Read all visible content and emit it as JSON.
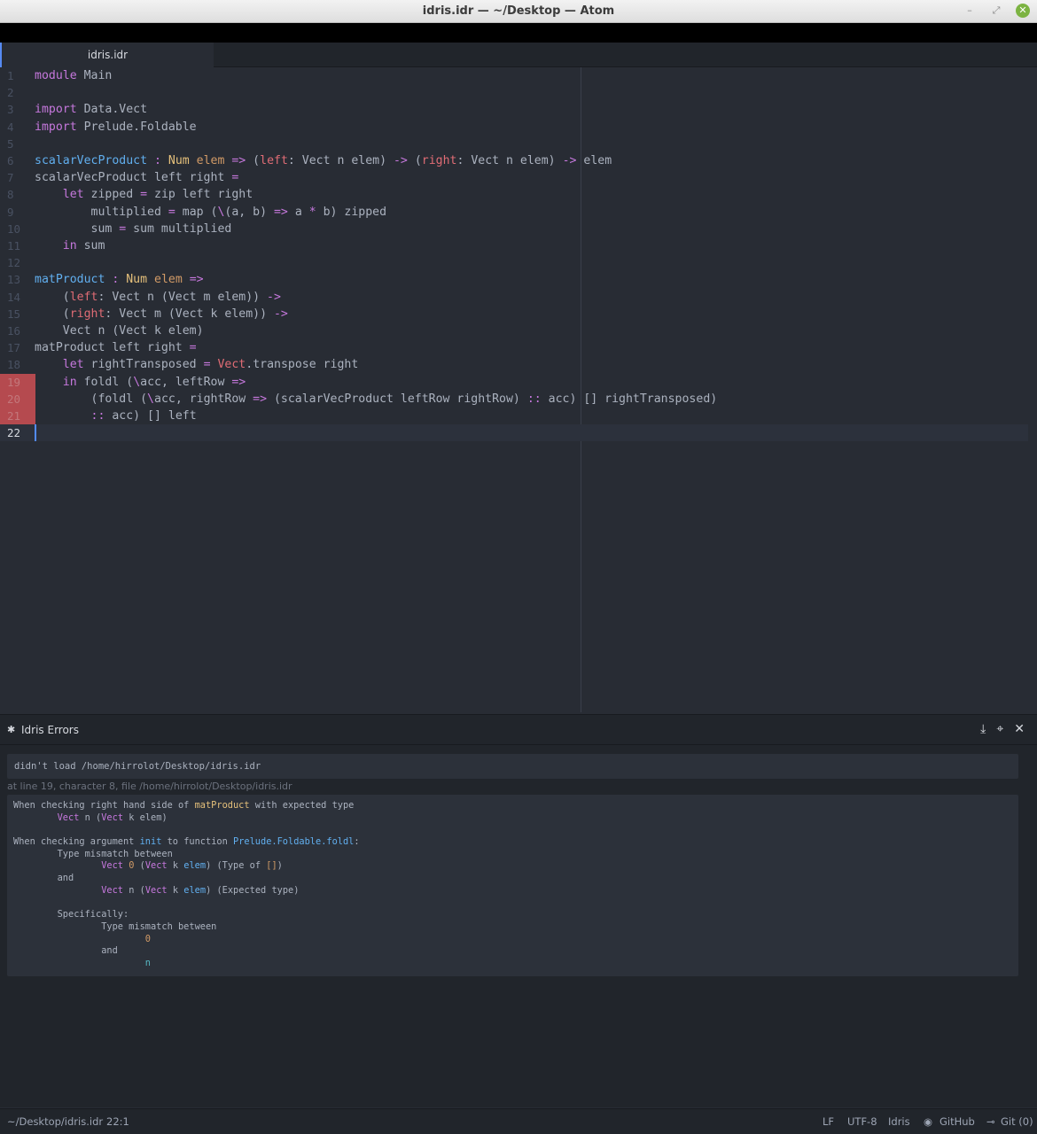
{
  "window": {
    "title": "idris.idr — ~/Desktop — Atom"
  },
  "tabs": [
    {
      "label": "idris.idr"
    }
  ],
  "editor": {
    "line_numbers": [
      "1",
      "2",
      "3",
      "4",
      "5",
      "6",
      "7",
      "8",
      "9",
      "10",
      "11",
      "12",
      "13",
      "14",
      "15",
      "16",
      "17",
      "18",
      "19",
      "20",
      "21",
      "22"
    ],
    "lines": [
      [
        {
          "t": "module",
          "c": "k"
        },
        {
          "t": " Main",
          "c": ""
        }
      ],
      [],
      [
        {
          "t": "import",
          "c": "k"
        },
        {
          "t": " Data.Vect",
          "c": ""
        }
      ],
      [
        {
          "t": "import",
          "c": "k"
        },
        {
          "t": " Prelude.Foldable",
          "c": ""
        }
      ],
      [],
      [
        {
          "t": "scalarVecProduct",
          "c": "f"
        },
        {
          "t": " : ",
          "c": "op"
        },
        {
          "t": "Num",
          "c": "t"
        },
        {
          "t": " elem",
          "c": "ty"
        },
        {
          "t": " => ",
          "c": "op"
        },
        {
          "t": "(",
          "c": ""
        },
        {
          "t": "left",
          "c": "v"
        },
        {
          "t": ": Vect n elem) ",
          "c": ""
        },
        {
          "t": "->",
          "c": "op"
        },
        {
          "t": " (",
          "c": ""
        },
        {
          "t": "right",
          "c": "v"
        },
        {
          "t": ": Vect n elem) ",
          "c": ""
        },
        {
          "t": "->",
          "c": "op"
        },
        {
          "t": " elem",
          "c": ""
        }
      ],
      [
        {
          "t": "scalarVecProduct left right ",
          "c": ""
        },
        {
          "t": "=",
          "c": "op"
        }
      ],
      [
        {
          "t": "    ",
          "c": ""
        },
        {
          "t": "let",
          "c": "k"
        },
        {
          "t": " zipped ",
          "c": ""
        },
        {
          "t": "=",
          "c": "op"
        },
        {
          "t": " zip left right",
          "c": ""
        }
      ],
      [
        {
          "t": "        multiplied ",
          "c": ""
        },
        {
          "t": "=",
          "c": "op"
        },
        {
          "t": " map (",
          "c": ""
        },
        {
          "t": "\\",
          "c": "op"
        },
        {
          "t": "(a, b) ",
          "c": ""
        },
        {
          "t": "=>",
          "c": "op"
        },
        {
          "t": " a ",
          "c": ""
        },
        {
          "t": "*",
          "c": "op"
        },
        {
          "t": " b) zipped",
          "c": ""
        }
      ],
      [
        {
          "t": "        sum ",
          "c": ""
        },
        {
          "t": "=",
          "c": "op"
        },
        {
          "t": " sum multiplied",
          "c": ""
        }
      ],
      [
        {
          "t": "    ",
          "c": ""
        },
        {
          "t": "in",
          "c": "k"
        },
        {
          "t": " sum",
          "c": ""
        }
      ],
      [],
      [
        {
          "t": "matProduct",
          "c": "f"
        },
        {
          "t": " : ",
          "c": "op"
        },
        {
          "t": "Num",
          "c": "t"
        },
        {
          "t": " elem",
          "c": "ty"
        },
        {
          "t": " =>",
          "c": "op"
        }
      ],
      [
        {
          "t": "    (",
          "c": ""
        },
        {
          "t": "left",
          "c": "v"
        },
        {
          "t": ": Vect n (Vect m elem)) ",
          "c": ""
        },
        {
          "t": "->",
          "c": "op"
        }
      ],
      [
        {
          "t": "    (",
          "c": ""
        },
        {
          "t": "right",
          "c": "v"
        },
        {
          "t": ": Vect m (Vect k elem)) ",
          "c": ""
        },
        {
          "t": "->",
          "c": "op"
        }
      ],
      [
        {
          "t": "    Vect n (Vect k elem)",
          "c": ""
        }
      ],
      [
        {
          "t": "matProduct left right ",
          "c": ""
        },
        {
          "t": "=",
          "c": "op"
        }
      ],
      [
        {
          "t": "    ",
          "c": ""
        },
        {
          "t": "let",
          "c": "k"
        },
        {
          "t": " rightTransposed ",
          "c": ""
        },
        {
          "t": "=",
          "c": "op"
        },
        {
          "t": " ",
          "c": ""
        },
        {
          "t": "Vect",
          "c": "v"
        },
        {
          "t": ".transpose right",
          "c": ""
        }
      ],
      [
        {
          "t": "    ",
          "c": ""
        },
        {
          "t": "in",
          "c": "k"
        },
        {
          "t": " foldl (",
          "c": ""
        },
        {
          "t": "\\",
          "c": "op"
        },
        {
          "t": "acc, leftRow ",
          "c": ""
        },
        {
          "t": "=>",
          "c": "op"
        }
      ],
      [
        {
          "t": "        (foldl (",
          "c": ""
        },
        {
          "t": "\\",
          "c": "op"
        },
        {
          "t": "acc, rightRow ",
          "c": ""
        },
        {
          "t": "=>",
          "c": "op"
        },
        {
          "t": " (scalarVecProduct leftRow rightRow) ",
          "c": ""
        },
        {
          "t": "::",
          "c": "op"
        },
        {
          "t": " acc) [] rightTransposed)",
          "c": ""
        }
      ],
      [
        {
          "t": "        ",
          "c": ""
        },
        {
          "t": "::",
          "c": "op"
        },
        {
          "t": " acc) [] left",
          "c": ""
        }
      ],
      []
    ],
    "error_lines": [
      19,
      20,
      21
    ],
    "cursor_line": 22
  },
  "error_panel": {
    "title": "Idris Errors",
    "message": "didn't load /home/hirrolot/Desktop/idris.idr",
    "location": "at line 19, character 8, file /home/hirrolot/Desktop/idris.idr",
    "detail": [
      [
        {
          "t": "When checking right hand side of ",
          "c": ""
        },
        {
          "t": "matProduct",
          "c": "py"
        },
        {
          "t": " with expected type",
          "c": ""
        }
      ],
      [
        {
          "t": "        ",
          "c": ""
        },
        {
          "t": "Vect",
          "c": "pm"
        },
        {
          "t": " n (",
          "c": ""
        },
        {
          "t": "Vect",
          "c": "pm"
        },
        {
          "t": " k elem)",
          "c": ""
        }
      ],
      [],
      [
        {
          "t": "When checking argument ",
          "c": ""
        },
        {
          "t": "init",
          "c": "pb"
        },
        {
          "t": " to function ",
          "c": ""
        },
        {
          "t": "Prelude.Foldable.foldl",
          "c": "pb"
        },
        {
          "t": ":",
          "c": ""
        }
      ],
      [
        {
          "t": "        Type mismatch between",
          "c": ""
        }
      ],
      [
        {
          "t": "                ",
          "c": ""
        },
        {
          "t": "Vect",
          "c": "pm"
        },
        {
          "t": " ",
          "c": ""
        },
        {
          "t": "0",
          "c": "po"
        },
        {
          "t": " (",
          "c": ""
        },
        {
          "t": "Vect",
          "c": "pm"
        },
        {
          "t": " k ",
          "c": ""
        },
        {
          "t": "elem",
          "c": "pb"
        },
        {
          "t": ") (Type of ",
          "c": ""
        },
        {
          "t": "[]",
          "c": "po"
        },
        {
          "t": ")",
          "c": ""
        }
      ],
      [
        {
          "t": "        and",
          "c": ""
        }
      ],
      [
        {
          "t": "                ",
          "c": ""
        },
        {
          "t": "Vect",
          "c": "pm"
        },
        {
          "t": " n (",
          "c": ""
        },
        {
          "t": "Vect",
          "c": "pm"
        },
        {
          "t": " k ",
          "c": ""
        },
        {
          "t": "elem",
          "c": "pb"
        },
        {
          "t": ") (Expected type)",
          "c": ""
        }
      ],
      [],
      [
        {
          "t": "        Specifically:",
          "c": ""
        }
      ],
      [
        {
          "t": "                Type mismatch between",
          "c": ""
        }
      ],
      [
        {
          "t": "                        ",
          "c": ""
        },
        {
          "t": "0",
          "c": "po"
        }
      ],
      [
        {
          "t": "                and",
          "c": ""
        }
      ],
      [
        {
          "t": "                        ",
          "c": ""
        },
        {
          "t": "n",
          "c": "pc"
        }
      ]
    ]
  },
  "status_bar": {
    "file_path": "~/Desktop/idris.idr",
    "cursor_position": "22:1",
    "line_ending": "LF",
    "encoding": "UTF-8",
    "grammar": "Idris",
    "github_label": "GitHub",
    "git_label": "Git (0)"
  },
  "colors": {
    "accent": "#568af2",
    "error_gutter": "#b54a4f",
    "background": "#282c34"
  }
}
